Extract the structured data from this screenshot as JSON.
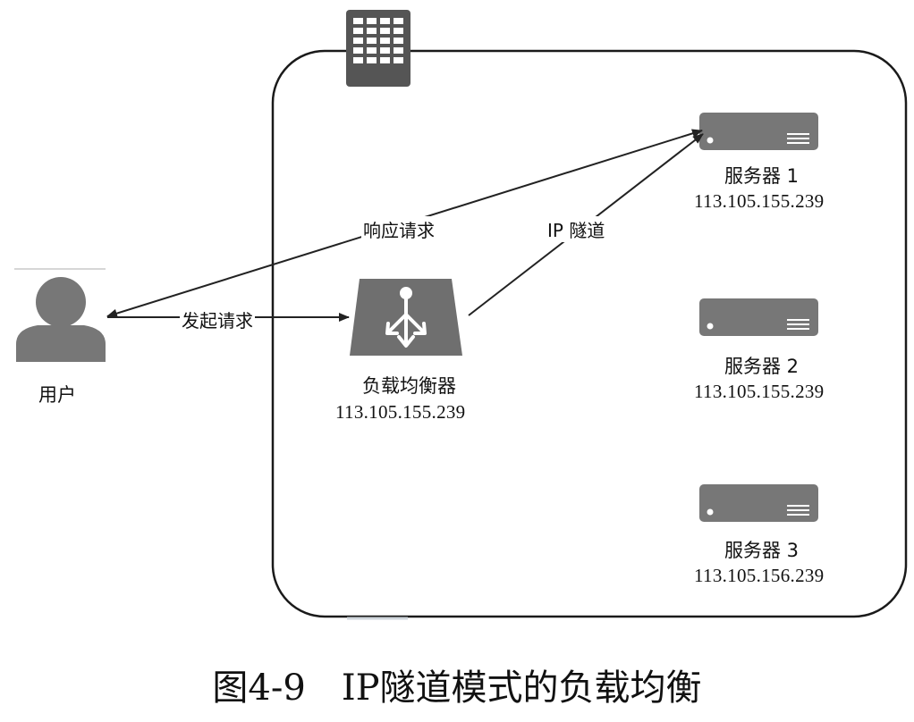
{
  "user": {
    "label": "用户"
  },
  "load_balancer": {
    "name": "负载均衡器",
    "ip": "113.105.155.239"
  },
  "servers": [
    {
      "name": "服务器 1",
      "ip": "113.105.155.239"
    },
    {
      "name": "服务器 2",
      "ip": "113.105.155.239"
    },
    {
      "name": "服务器 3",
      "ip": "113.105.156.239"
    }
  ],
  "edges": {
    "request": "发起请求",
    "response": "响应请求",
    "tunnel": "IP 隧道"
  },
  "caption": "图4-9　IP隧道模式的负载均衡",
  "colors": {
    "icon": "#6a6a6a",
    "dark_icon": "#555555",
    "line": "#222222",
    "frame": "#1a1a1a"
  }
}
